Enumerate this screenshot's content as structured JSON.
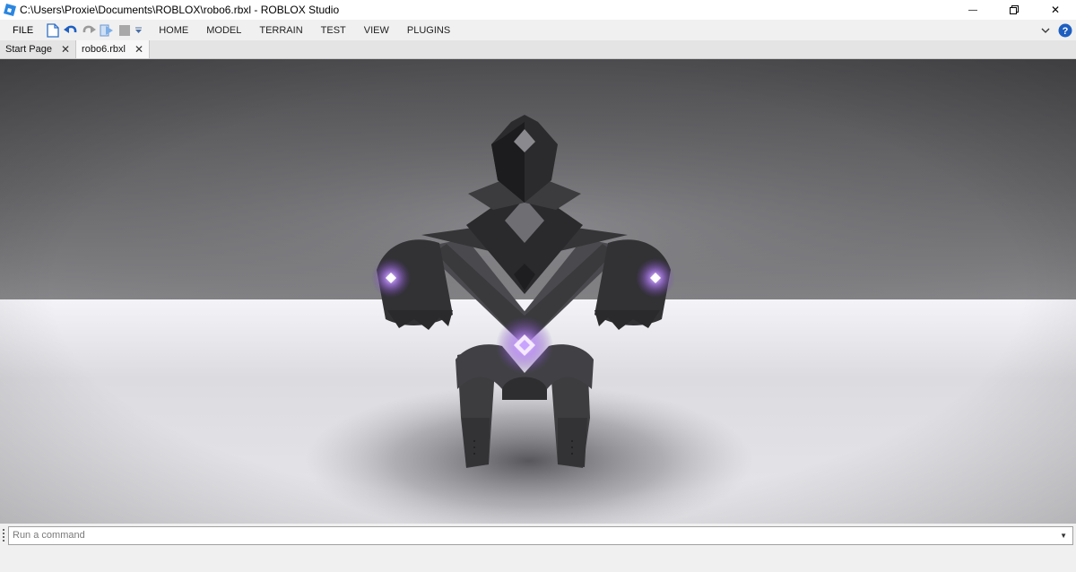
{
  "window": {
    "title": "C:\\Users\\Proxie\\Documents\\ROBLOX\\robo6.rbxl - ROBLOX Studio",
    "minimize_glyph": "—",
    "close_glyph": "✕"
  },
  "menubar": {
    "file_label": "FILE",
    "tabs": [
      "HOME",
      "MODEL",
      "TERRAIN",
      "TEST",
      "VIEW",
      "PLUGINS"
    ]
  },
  "doc_tabs": [
    {
      "label": "Start Page",
      "active": false
    },
    {
      "label": "robo6.rbxl",
      "active": true
    }
  ],
  "command_bar": {
    "placeholder": "Run a command"
  },
  "colors": {
    "accent_blue": "#1e66c4",
    "glow": "#c89bff",
    "robot_body": "#3b3b3e"
  }
}
